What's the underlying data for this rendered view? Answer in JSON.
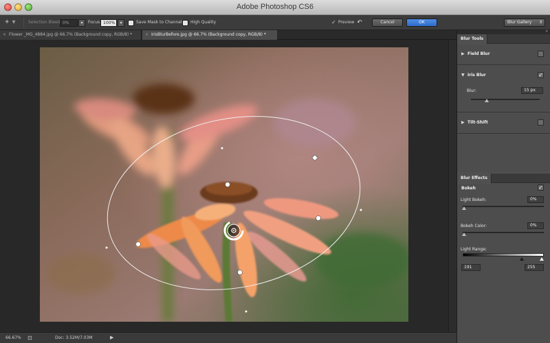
{
  "window": {
    "title": "Adobe Photoshop CS6"
  },
  "options_bar": {
    "selection_bleed_label": "Selection Bleed:",
    "selection_bleed_value": "0%",
    "focus_label": "Focus:",
    "focus_value": "100%",
    "save_mask_label": "Save Mask to Channels",
    "high_quality_label": "High Quality",
    "preview_label": "Preview",
    "preview_checked": true,
    "cancel_label": "Cancel",
    "ok_label": "OK",
    "gallery_label": "Blur Gallery"
  },
  "tabs": [
    {
      "label": "Flower _MG_4884.jpg @ 66.7% (Background copy, RGB/8) *",
      "active": false
    },
    {
      "label": "IrisBlurBefore.jpg @ 66.7% (Background copy, RGB/8) *",
      "active": true
    }
  ],
  "status_bar": {
    "zoom": "66.67%",
    "doc": "Doc: 3.52M/7.03M"
  },
  "blur_tools": {
    "panel_title": "Blur Tools",
    "field_blur": {
      "label": "Field Blur",
      "checked": false
    },
    "iris_blur": {
      "label": "Iris Blur",
      "checked": true,
      "blur_label": "Blur:",
      "blur_value": "15 px",
      "blur_level": 0.3
    },
    "tilt_shift": {
      "label": "Tilt-Shift",
      "checked": false
    }
  },
  "blur_effects": {
    "panel_title": "Blur Effects",
    "bokeh": {
      "label": "Bokeh",
      "checked": true
    },
    "light_bokeh": {
      "label": "Light Bokeh:",
      "value": "0%",
      "level": 0
    },
    "bokeh_color": {
      "label": "Bokeh Color:",
      "value": "0%",
      "level": 0
    },
    "light_range": {
      "label": "Light Range:",
      "min": "191",
      "max": "255"
    }
  },
  "colors": {
    "accent_blue": "#3a78d6",
    "panel_bg": "#505050"
  },
  "icons": {
    "tool": "pin-tool-icon",
    "undo": "undo-icon",
    "collapse": "collapse-panel-icon"
  }
}
